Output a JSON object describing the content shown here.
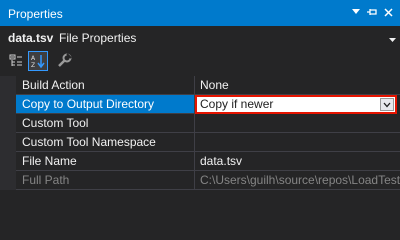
{
  "panel": {
    "title": "Properties",
    "controls": {
      "dropdown_icon": "caret-down-icon",
      "pin_icon": "pin-icon",
      "close_icon": "close-icon"
    }
  },
  "object_selector": {
    "name": "data.tsv",
    "description": "File Properties"
  },
  "toolbar": {
    "buttons": [
      {
        "icon": "categorized-icon",
        "active": false
      },
      {
        "icon": "alphabetical-icon",
        "active": true
      },
      {
        "icon": "property-pages-icon",
        "active": false
      }
    ]
  },
  "properties": [
    {
      "name": "Build Action",
      "value": "None"
    },
    {
      "name": "Copy to Output Directory",
      "value": "Copy if newer",
      "selected": true,
      "editor": "dropdown"
    },
    {
      "name": "Custom Tool",
      "value": ""
    },
    {
      "name": "Custom Tool Namespace",
      "value": ""
    },
    {
      "name": "File Name",
      "value": "data.tsv"
    },
    {
      "name": "Full Path",
      "value": "C:\\Users\\guilh\\source\\repos\\LoadTest",
      "disabled": true
    }
  ],
  "colors": {
    "accent": "#007acc",
    "highlight_border": "#e51400",
    "background": "#252526"
  }
}
